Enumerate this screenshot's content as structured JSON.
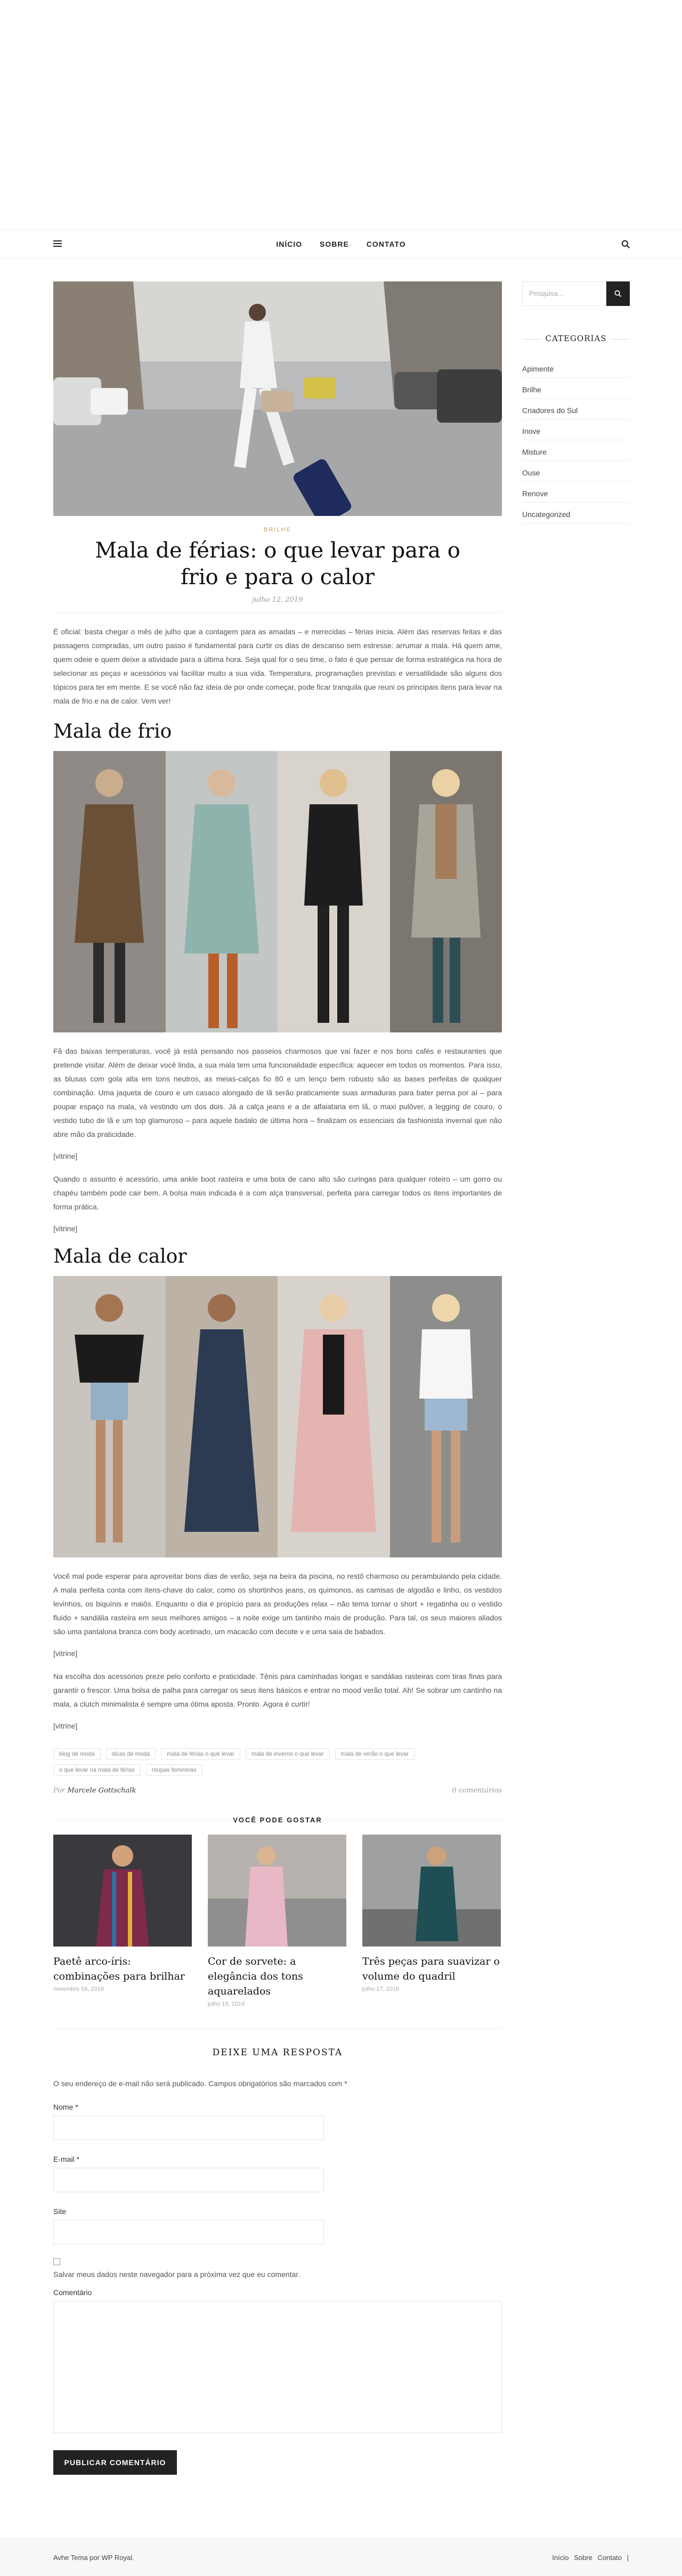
{
  "nav": {
    "items": [
      "INÍCIO",
      "SOBRE",
      "CONTATO"
    ]
  },
  "post": {
    "category": "BRILHE",
    "title": "Mala de férias: o que levar para o frio e para o calor",
    "date": "julho 12, 2019",
    "intro": "É oficial: basta chegar o mês de julho que a contagem para as amadas – e merecidas – férias inicia. Além das reservas feitas e das passagens compradas, um outro passo é fundamental para curtir os dias de descanso sem estresse: arrumar a mala. Há quem ame, quem odeie e quem deixe a atividade para a última hora. Seja qual for o seu time, o fato é que pensar de forma estratégica na hora de selecionar as peças e acessórios vai facilitar muito a sua vida. Temperatura, programações previstas e versatilidade são alguns dos tópicos para ter em mente. E se você não faz ideia de por onde começar, pode ficar tranquila que reuni os principais itens para levar na mala de frio e na de calor. Vem ver!",
    "section1_title": "Mala de frio",
    "section1_p1": "Fã das baixas temperaturas, você já está pensando nos passeios charmosos que vai fazer e nos bons cafés e restaurantes que pretende visitar. Além de deixar você linda, a sua mala tem uma funcionalidade específica: aquecer em todos os momentos. Para isso, as blusas com gola alta em tons neutros, as meias-calças fio 80 e um lenço bem robusto são as bases perfeitas de qualquer combinação. Uma jaqueta de couro e um casaco alongado de lã serão praticamente suas armaduras para bater perna por aí – para poupar espaço na mala, vá vestindo um dos dois. Já a calça jeans e a de alfaiataria em lã, o maxi pulôver, a legging de couro, o vestido tubo de lã e um top glamuroso – para aquele badalo de última hora – finalizam os essenciais da fashionista invernal que não abre mão da praticidade.",
    "vitrine1": "[vitrine]",
    "section1_p2": "Quando o assunto é acessório, uma ankle boot rasteira e uma bota de cano alto são curingas para qualquer roteiro – um gorro ou chapéu também pode cair bem. A bolsa mais indicada é a com alça transversal, perfeita para carregar todos os itens importantes de forma prática.",
    "vitrine2": "[vitrine]",
    "section2_title": "Mala de calor",
    "section2_p1": "Você mal pode esperar para aproveitar bons dias de verão, seja na beira da piscina, no restô charmoso ou perambulando pela cidade. A mala perfeita conta com itens-chave do calor, como os shortinhos jeans, os quimonos, as camisas de algodão e linho, os vestidos levinhos, os biquínis e maiôs. Enquanto o dia é propício para as produções relax – não tema tornar o short + regatinha ou o vestido fluido + sandália rasteira em seus melhores amigos – a noite exige um tantinho mais de produção. Para tal, os seus maiores aliados são uma pantalona branca com body acetinado, um macacão com decote v e uma saia de babados.",
    "vitrine3": "[vitrine]",
    "section2_p2": "Na escolha dos acessórios preze pelo conforto e praticidade. Tênis para caminhadas longas e sandálias rasteiras com tiras finas para garantir o frescor. Uma bolsa de palha para carregar os seus itens básicos e entrar no mood verão total. Ah! Se sobrar um cantinho na mala, a clutch minimalista é sempre uma ótima aposta. Pronto. Agora é curtir!",
    "vitrine4": "[vitrine]",
    "tags": [
      "blog de moda",
      "dicas de moda",
      "mala de férias o que levar",
      "mala de inverno o que levar",
      "mala de verão o que levar",
      "o que levar na mala de férias",
      "roupas femininas"
    ],
    "author_prefix": "Por",
    "author": "Marcele Gottschalk",
    "comments_count": "0 comentários"
  },
  "related": {
    "title": "VOCÊ PODE GOSTAR",
    "items": [
      {
        "title": "Paetê arco-íris: combinações para brilhar",
        "date": "novembro 16, 2018"
      },
      {
        "title": "Cor de sorvete: a elegância dos tons aquarelados",
        "date": "julho 18, 2019"
      },
      {
        "title": "Três peças para suavizar o volume do quadril",
        "date": "julho 17, 2018"
      }
    ]
  },
  "comment_form": {
    "title": "DEIXE UMA RESPOSTA",
    "note": "O seu endereço de e-mail não será publicado. Campos obrigatórios são marcados com *",
    "name_label": "Nome *",
    "email_label": "E-mail *",
    "site_label": "Site",
    "save_label": "Salvar meus dados neste navegador para a próxima vez que eu comentar.",
    "comment_label": "Comentário",
    "submit_label": "PUBLICAR COMENTÁRIO"
  },
  "sidebar": {
    "search_placeholder": "Pesquisa...",
    "categories_title": "CATEGORIAS",
    "categories": [
      "Apimente",
      "Brilhe",
      "Criadores do Sul",
      "Inove",
      "Misture",
      "Ouse",
      "Renove",
      "Uncategorized"
    ]
  },
  "footer": {
    "credit": "Avhe Tema por WP Royal.",
    "links": [
      "Início",
      "Sobre",
      "Contato"
    ],
    "separator": "|"
  },
  "colors": {
    "accent": "#c9a15b",
    "dark": "#222222"
  }
}
